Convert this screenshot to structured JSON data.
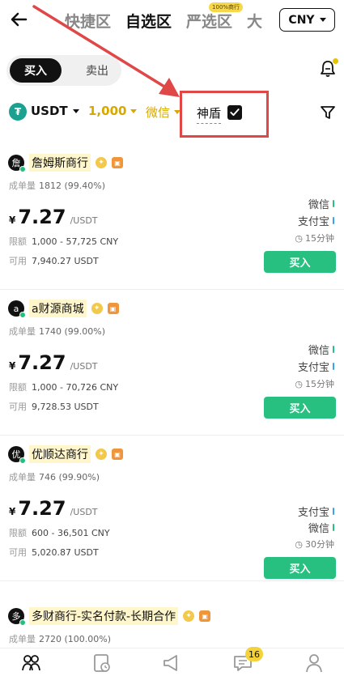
{
  "header": {
    "tabs": [
      {
        "label": "快捷区"
      },
      {
        "label": "自选区"
      },
      {
        "label": "严选区",
        "badge": "100%商行"
      },
      {
        "label": "大"
      }
    ],
    "currency": "CNY"
  },
  "trade_toggle": {
    "buy": "买入",
    "sell": "卖出"
  },
  "filters": {
    "coin": "USDT",
    "amount": "1,000",
    "payment": "微信",
    "shield_label": "神盾",
    "shield_checked": true
  },
  "colors": {
    "accent": "#d6a800",
    "buy": "#28c081",
    "highlight_box": "#e04848",
    "wechat": "#28c081",
    "alipay": "#3aa0f0"
  },
  "merchants": [
    {
      "avatar": "詹",
      "name": "詹姆斯商行",
      "orders_label": "成单量",
      "orders": "1812 (99.40%)",
      "currency_symbol": "¥",
      "price": "7.27",
      "unit": "/USDT",
      "limit_label": "限额",
      "limit": "1,000 - 57,725 CNY",
      "avail_label": "可用",
      "avail": "7,940.27 USDT",
      "payments": [
        "微信",
        "支付宝"
      ],
      "time": "15分钟",
      "buy": "买入"
    },
    {
      "avatar": "a",
      "name": "a财源商城",
      "orders_label": "成单量",
      "orders": "1740 (99.00%)",
      "currency_symbol": "¥",
      "price": "7.27",
      "unit": "/USDT",
      "limit_label": "限额",
      "limit": "1,000 - 70,726 CNY",
      "avail_label": "可用",
      "avail": "9,728.53 USDT",
      "payments": [
        "微信",
        "支付宝"
      ],
      "time": "15分钟",
      "buy": "买入"
    },
    {
      "avatar": "优",
      "name": "优顺达商行",
      "orders_label": "成单量",
      "orders": "746 (99.90%)",
      "currency_symbol": "¥",
      "price": "7.27",
      "unit": "/USDT",
      "limit_label": "限额",
      "limit": "600 - 36,501 CNY",
      "avail_label": "可用",
      "avail": "5,020.87 USDT",
      "payments": [
        "支付宝",
        "微信"
      ],
      "time": "30分钟",
      "buy": "买入"
    },
    {
      "avatar": "多",
      "name": "多财商行-实名付款-长期合作",
      "orders_label": "成单量",
      "orders": "2720 (100.00%)"
    }
  ],
  "bottom_nav": {
    "messages_badge": "16"
  }
}
